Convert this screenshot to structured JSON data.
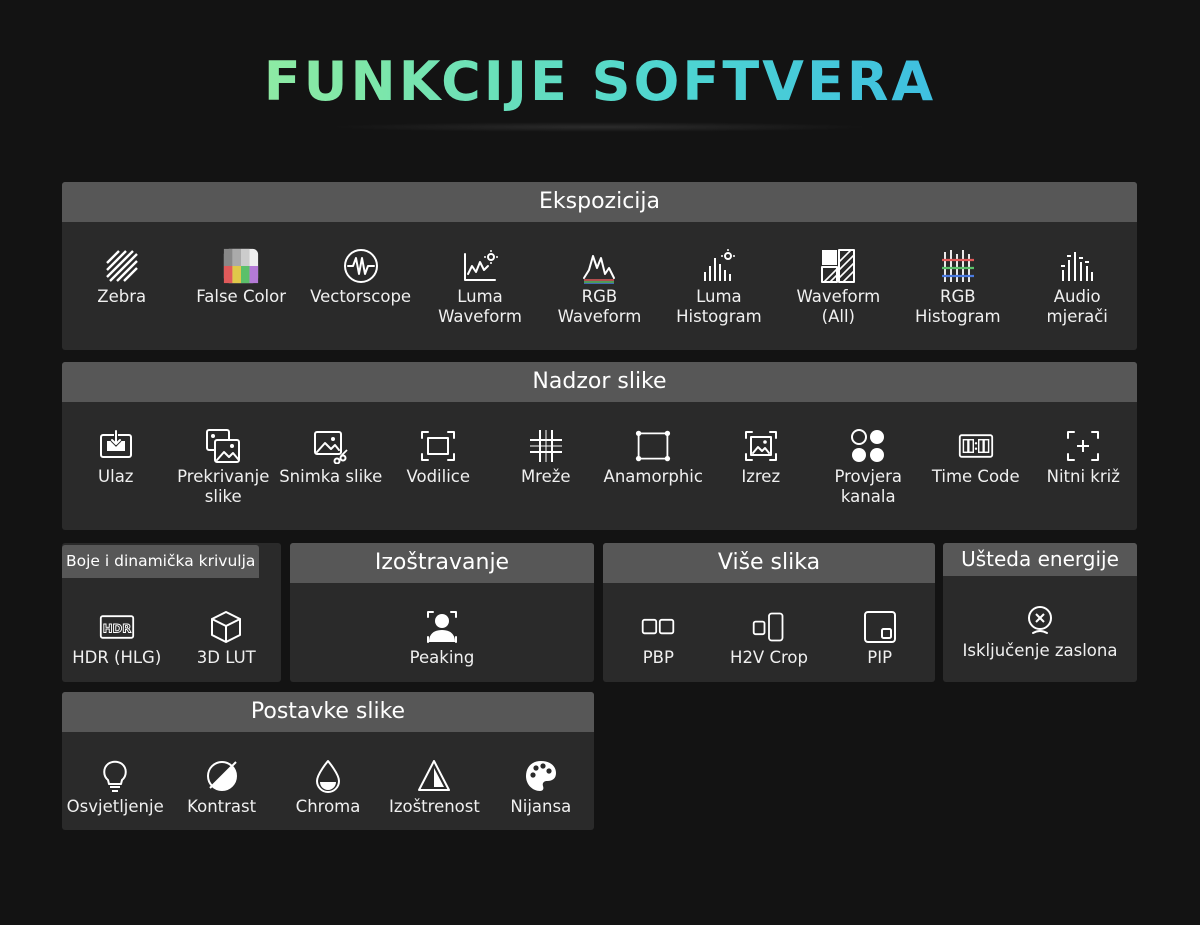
{
  "title": "FUNKCIJE SOFTVERA",
  "sections": {
    "ekspozicija": {
      "header": "Ekspozicija",
      "items": [
        {
          "icon": "zebra-icon",
          "l1": "Zebra",
          "l2": ""
        },
        {
          "icon": "false-color-icon",
          "l1": "False Color",
          "l2": ""
        },
        {
          "icon": "vectorscope-icon",
          "l1": "Vectorscope",
          "l2": ""
        },
        {
          "icon": "luma-waveform-icon",
          "l1": "Luma",
          "l2": "Waveform"
        },
        {
          "icon": "rgb-waveform-icon",
          "l1": "RGB",
          "l2": "Waveform"
        },
        {
          "icon": "luma-histogram-icon",
          "l1": "Luma",
          "l2": "Histogram"
        },
        {
          "icon": "waveform-all-icon",
          "l1": "Waveform",
          "l2": "(All)"
        },
        {
          "icon": "rgb-histogram-icon",
          "l1": "RGB",
          "l2": "Histogram"
        },
        {
          "icon": "audio-meter-icon",
          "l1": "Audio",
          "l2": "mjerači"
        }
      ]
    },
    "nadzor": {
      "header": "Nadzor slike",
      "items": [
        {
          "icon": "input-icon",
          "l1": "Ulaz",
          "l2": ""
        },
        {
          "icon": "overlay-icon",
          "l1": "Prekrivanje",
          "l2": "slike"
        },
        {
          "icon": "snapshot-icon",
          "l1": "Snimka slike",
          "l2": ""
        },
        {
          "icon": "guides-icon",
          "l1": "Vodilice",
          "l2": ""
        },
        {
          "icon": "grid-icon",
          "l1": "Mreže",
          "l2": ""
        },
        {
          "icon": "anamorphic-icon",
          "l1": "Anamorphic",
          "l2": ""
        },
        {
          "icon": "crop-icon",
          "l1": "Izrez",
          "l2": ""
        },
        {
          "icon": "channel-check-icon",
          "l1": "Provjera",
          "l2": "kanala"
        },
        {
          "icon": "time-code-icon",
          "l1": "Time Code",
          "l2": ""
        },
        {
          "icon": "crosshair-icon",
          "l1": "Nitni križ",
          "l2": ""
        }
      ]
    },
    "boje": {
      "header": "Boje i dinamička krivulja",
      "items": [
        {
          "icon": "hdr-icon",
          "l1": "HDR (HLG)",
          "l2": ""
        },
        {
          "icon": "lut-cube-icon",
          "l1": "3D LUT",
          "l2": ""
        }
      ]
    },
    "izostravanje": {
      "header": "Izoštravanje",
      "items": [
        {
          "icon": "peaking-icon",
          "l1": "Peaking",
          "l2": ""
        }
      ]
    },
    "vise": {
      "header": "Više slika",
      "items": [
        {
          "icon": "pbp-icon",
          "l1": "PBP",
          "l2": ""
        },
        {
          "icon": "h2v-crop-icon",
          "l1": "H2V Crop",
          "l2": ""
        },
        {
          "icon": "pip-icon",
          "l1": "PIP",
          "l2": ""
        }
      ]
    },
    "usteda": {
      "header": "Ušteda energije",
      "items": [
        {
          "icon": "screen-off-icon",
          "l1": "Isključenje zaslona",
          "l2": ""
        }
      ]
    },
    "postavke": {
      "header": "Postavke slike",
      "items": [
        {
          "icon": "brightness-bulb-icon",
          "l1": "Osvjetljenje",
          "l2": ""
        },
        {
          "icon": "contrast-icon",
          "l1": "Kontrast",
          "l2": ""
        },
        {
          "icon": "chroma-drop-icon",
          "l1": "Chroma",
          "l2": ""
        },
        {
          "icon": "sharpness-icon",
          "l1": "Izoštrenost",
          "l2": ""
        },
        {
          "icon": "hue-palette-icon",
          "l1": "Nijansa",
          "l2": ""
        }
      ]
    }
  }
}
